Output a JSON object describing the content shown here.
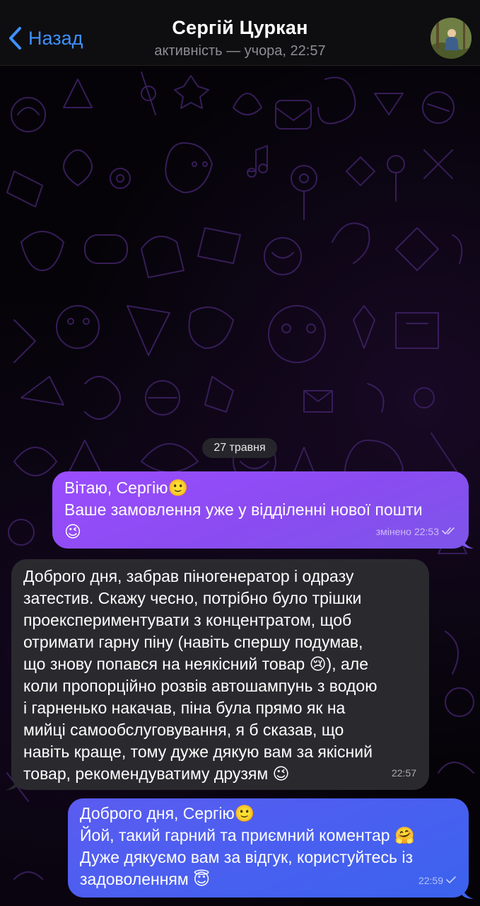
{
  "header": {
    "back_label": "Назад",
    "contact_name": "Сергій Цуркан",
    "status": "активність — учора, 22:57"
  },
  "chat": {
    "date_separator": "27 травня",
    "messages": [
      {
        "direction": "outgoing",
        "lines": [
          "Вітаю, Сергію🙂",
          "Ваше замовлення уже у відділенні нової пошти",
          "😉"
        ],
        "edited_label": "змінено",
        "time": "22:53",
        "status": "read"
      },
      {
        "direction": "incoming",
        "lines": [
          "Доброго дня, забрав піногенератор і одразу",
          "затестив. Скажу чесно, потрібно було трішки",
          "проекспериментувати з концентратом, щоб",
          "отримати гарну піну (навіть спершу подумав,",
          "що знову попався на неякісний товар 😢), але",
          "коли пропорційно розвів автошампунь з водою",
          "і гарненько накачав, піна була прямо як на",
          "мийці самообслуговування, я б сказав, що",
          "навіть краще, тому дуже дякую вам за якісний",
          "товар, рекомендуватиму друзям 😉"
        ],
        "time": "22:57"
      },
      {
        "direction": "outgoing",
        "lines": [
          "Доброго дня, Сергію🙂",
          "Йой, такий гарний та приємний коментар 🤗",
          "Дуже дякуємо вам за відгук, користуйтесь із",
          "задоволенням 😇"
        ],
        "time": "22:59",
        "status": "delivered"
      }
    ]
  },
  "colors": {
    "accent": "#3e91ff",
    "outgoing_bubble_1": "#8a4cf0",
    "outgoing_bubble_2": "#4a5ff0",
    "incoming_bubble": "#2a2a2e"
  },
  "icons": {
    "back": "chevron-left-icon",
    "read_receipt": "double-check-icon",
    "delivered_receipt": "check-icon"
  }
}
